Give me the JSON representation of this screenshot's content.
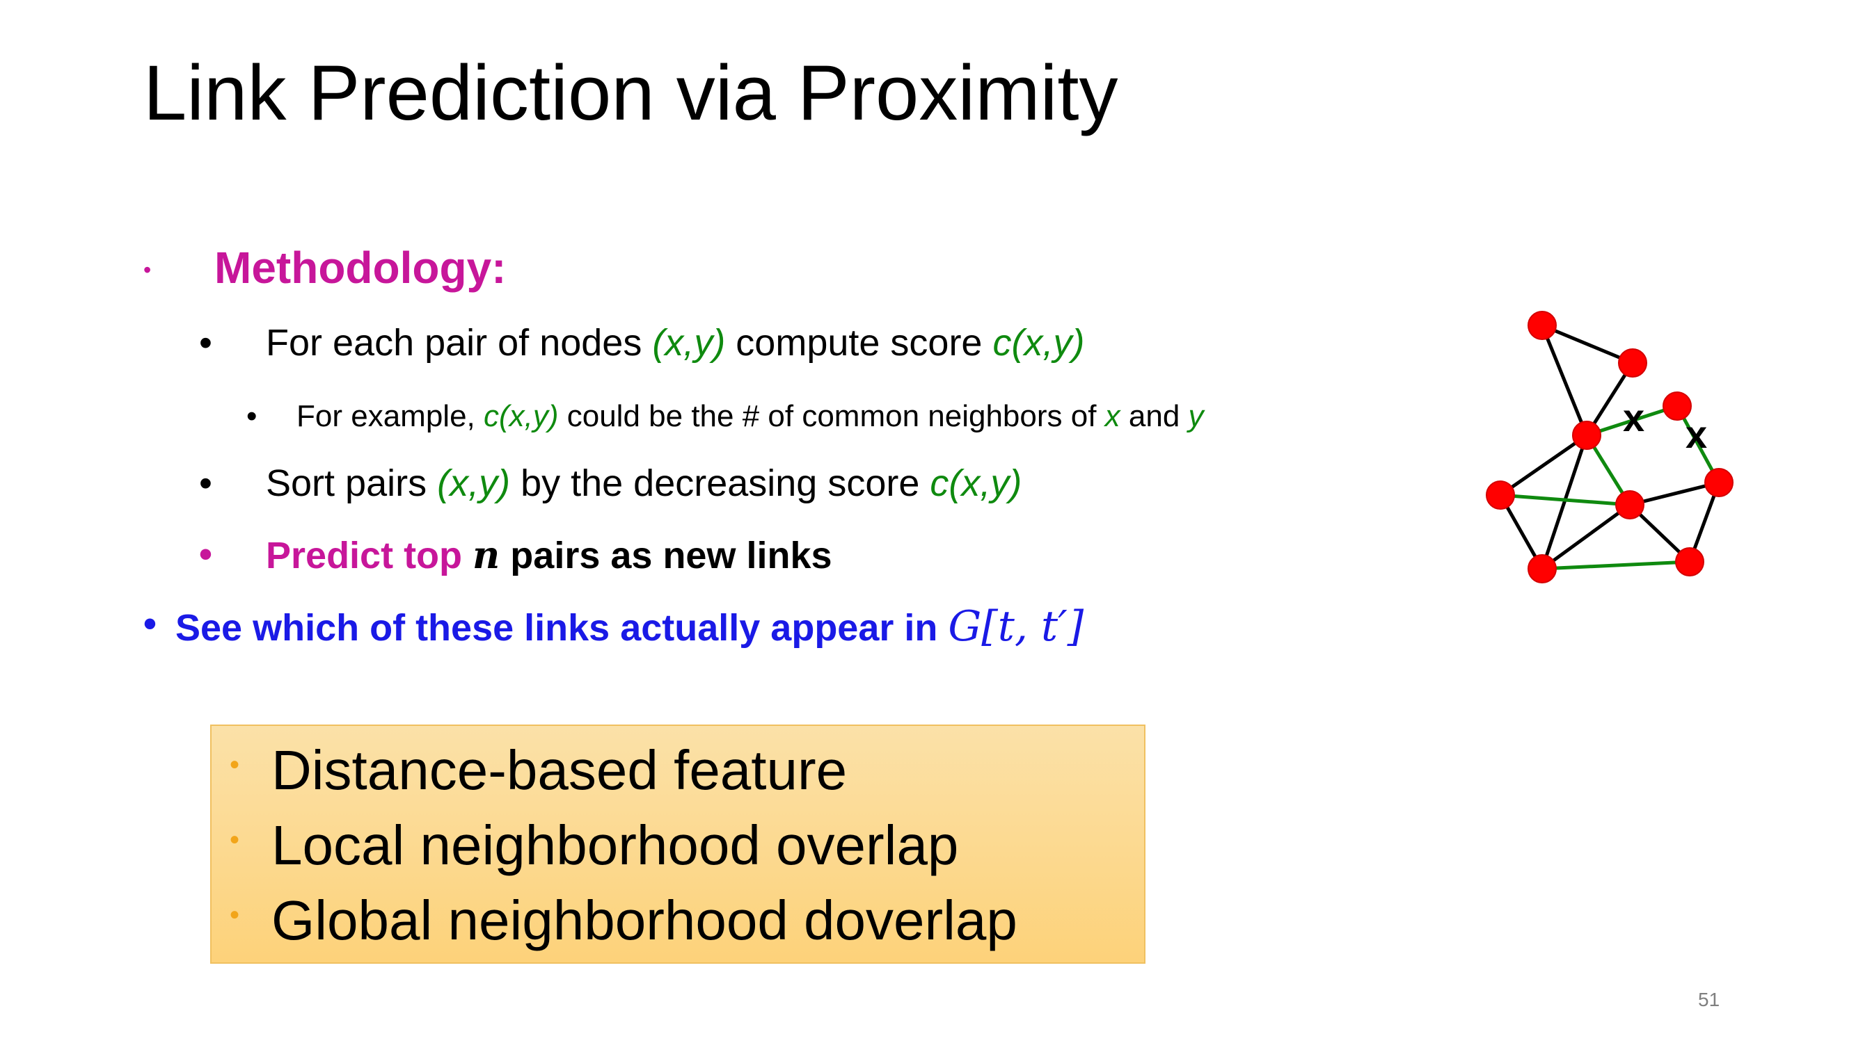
{
  "slide": {
    "title": "Link Prediction via Proximity",
    "page_number": "51"
  },
  "methodology": {
    "bullet": "•",
    "label": "Methodology:"
  },
  "steps": {
    "s1": {
      "a": "For each pair of nodes ",
      "b": "(x,y)",
      "c": " compute score  ",
      "d": "c(x,y)"
    },
    "s1sub": {
      "a": "For example, ",
      "b": "c(x,y)",
      "c": " could be the # of common neighbors of ",
      "d": "x",
      "e": " and ",
      "f": "y"
    },
    "s2": {
      "a": "Sort pairs ",
      "b": "(x,y)",
      "c": " by the decreasing score ",
      "d": "c(x,y)"
    },
    "s3": {
      "a": "Predict top ",
      "b": "n",
      "c": " pairs as new links"
    },
    "s4": {
      "a": "See which of these links actually appear in ",
      "b": "G[t, t′]"
    }
  },
  "features_box": {
    "items": [
      "Distance-based feature",
      "Local neighborhood overlap",
      "Global neighborhood doverlap"
    ]
  },
  "graph": {
    "marks": [
      "x",
      "x"
    ],
    "colors": {
      "node": "#ff0000",
      "edge": "#000000",
      "predicted_edge": "#0f8a0f"
    }
  }
}
